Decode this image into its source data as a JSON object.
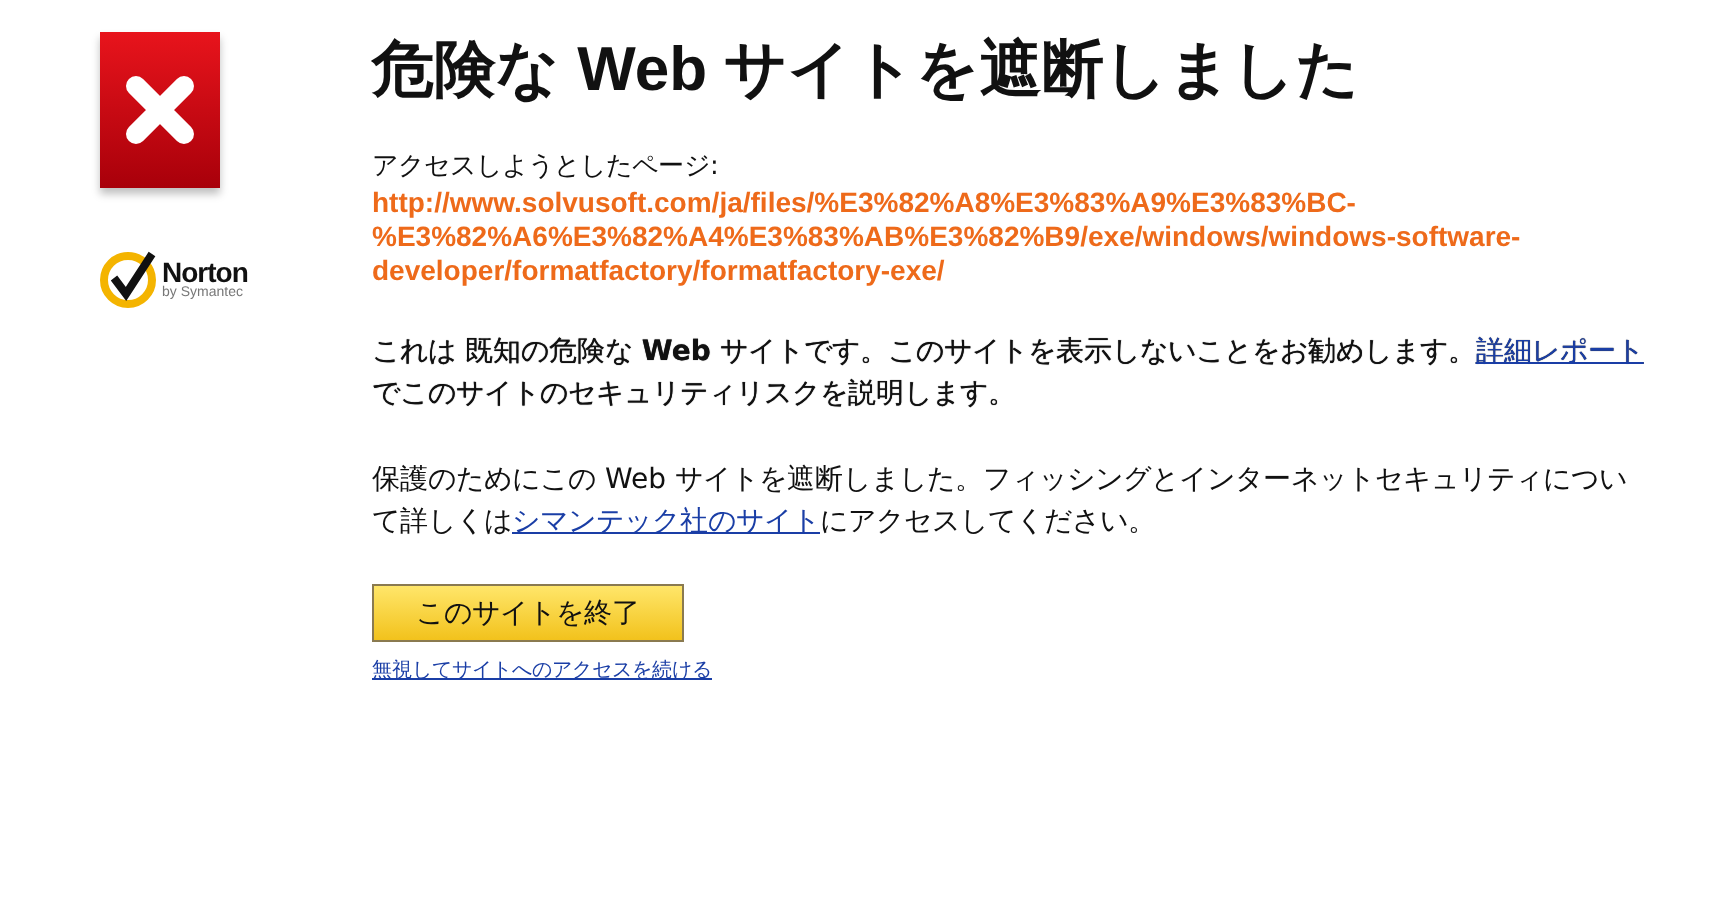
{
  "title": "危険な **Web** サイトを遮断しました",
  "logo": {
    "name": "Norton",
    "byline": "by Symantec"
  },
  "attempted_label": "アクセスしようとしたページ:",
  "attempted_url": "http://www.solvusoft.com/ja/files/%E3%82%A8%E3%83%A9%E3%83%BC-%E3%82%A6%E3%82%A4%E3%83%AB%E3%82%B9/exe/windows/windows-software-developer/formatfactory/formatfactory-exe/",
  "paragraphs": [
    {
      "before": "これは 既知の危険な **Web** サイトです。このサイトを表示しないことをお勧めします。",
      "link": "詳細レポート",
      "after": "でこのサイトのセキュリティリスクを説明します。",
      "emphasis": true
    },
    {
      "before": "保護のためにこの Web サイトを遮断しました。フィッシングとインターネットセキュリティについて詳しくは",
      "link": "シマンテック社のサイト",
      "after": "にアクセスしてください。",
      "emphasis": false
    }
  ],
  "exit_button": "このサイトを終了",
  "continue_link": "無視してサイトへのアクセスを続ける"
}
